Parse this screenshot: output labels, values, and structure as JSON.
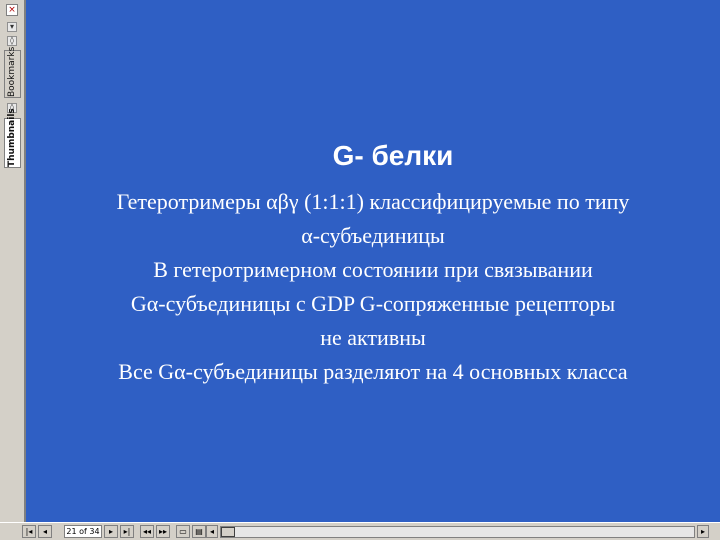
{
  "side_panel": {
    "close_glyph": "×",
    "tabs": [
      {
        "label": "Bookmarks",
        "active": false
      },
      {
        "label": "Thumbnails",
        "active": true
      }
    ]
  },
  "slide": {
    "title": "G- белки",
    "body_lines": [
      "Гетеротримеры αβγ (1:1:1) классифицируемые по типу",
      "α-субъединицы",
      "В гетеротримерном состоянии  при связывании",
      "Gα-субъединицы с GDP G-сопряженные рецепторы",
      "не активны",
      "Все Gα-субъединицы разделяют на 4 основных класса"
    ]
  },
  "bottom_bar": {
    "page_indicator": "21 of 34",
    "buttons": {
      "first": "|◂",
      "prev": "◂",
      "next": "▸",
      "last": "▸|",
      "back": "◂◂",
      "forward": "▸▸",
      "view1": "▭",
      "view2": "▤",
      "scroll_left": "◂",
      "scroll_right": "▸"
    }
  }
}
